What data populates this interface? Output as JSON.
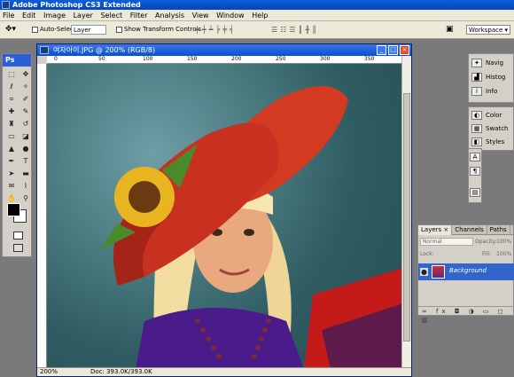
{
  "app": {
    "title": "Adobe Photoshop CS3 Extended"
  },
  "menu": [
    "File",
    "Edit",
    "Image",
    "Layer",
    "Select",
    "Filter",
    "Analysis",
    "View",
    "Window",
    "Help"
  ],
  "options": {
    "auto_select_label": "Auto-Select:",
    "auto_select_value": "Layer",
    "show_transform": "Show Transform Controls",
    "workspace": "Workspace ▾"
  },
  "toolbox": {
    "label": "Ps"
  },
  "document": {
    "title": "여자아이.JPG @ 200% (RGB/8)",
    "zoom": "200%",
    "doc_size": "Doc: 393.0K/393.0K",
    "ruler_marks": [
      "0",
      "50",
      "100",
      "150",
      "200",
      "250",
      "300",
      "350"
    ]
  },
  "panels": {
    "navigator": "Navig",
    "histogram": "Histog",
    "info": "Info",
    "color": "Color",
    "swatches": "Swatch",
    "styles": "Styles"
  },
  "layers": {
    "tabs": [
      "Layers ×",
      "Channels",
      "Paths"
    ],
    "blend_mode": "Normal",
    "opacity_label": "Opacity:",
    "opacity": "100%",
    "lock_label": "Lock:",
    "fill_label": "Fill:",
    "fill": "100%",
    "layer_name": "Background"
  }
}
